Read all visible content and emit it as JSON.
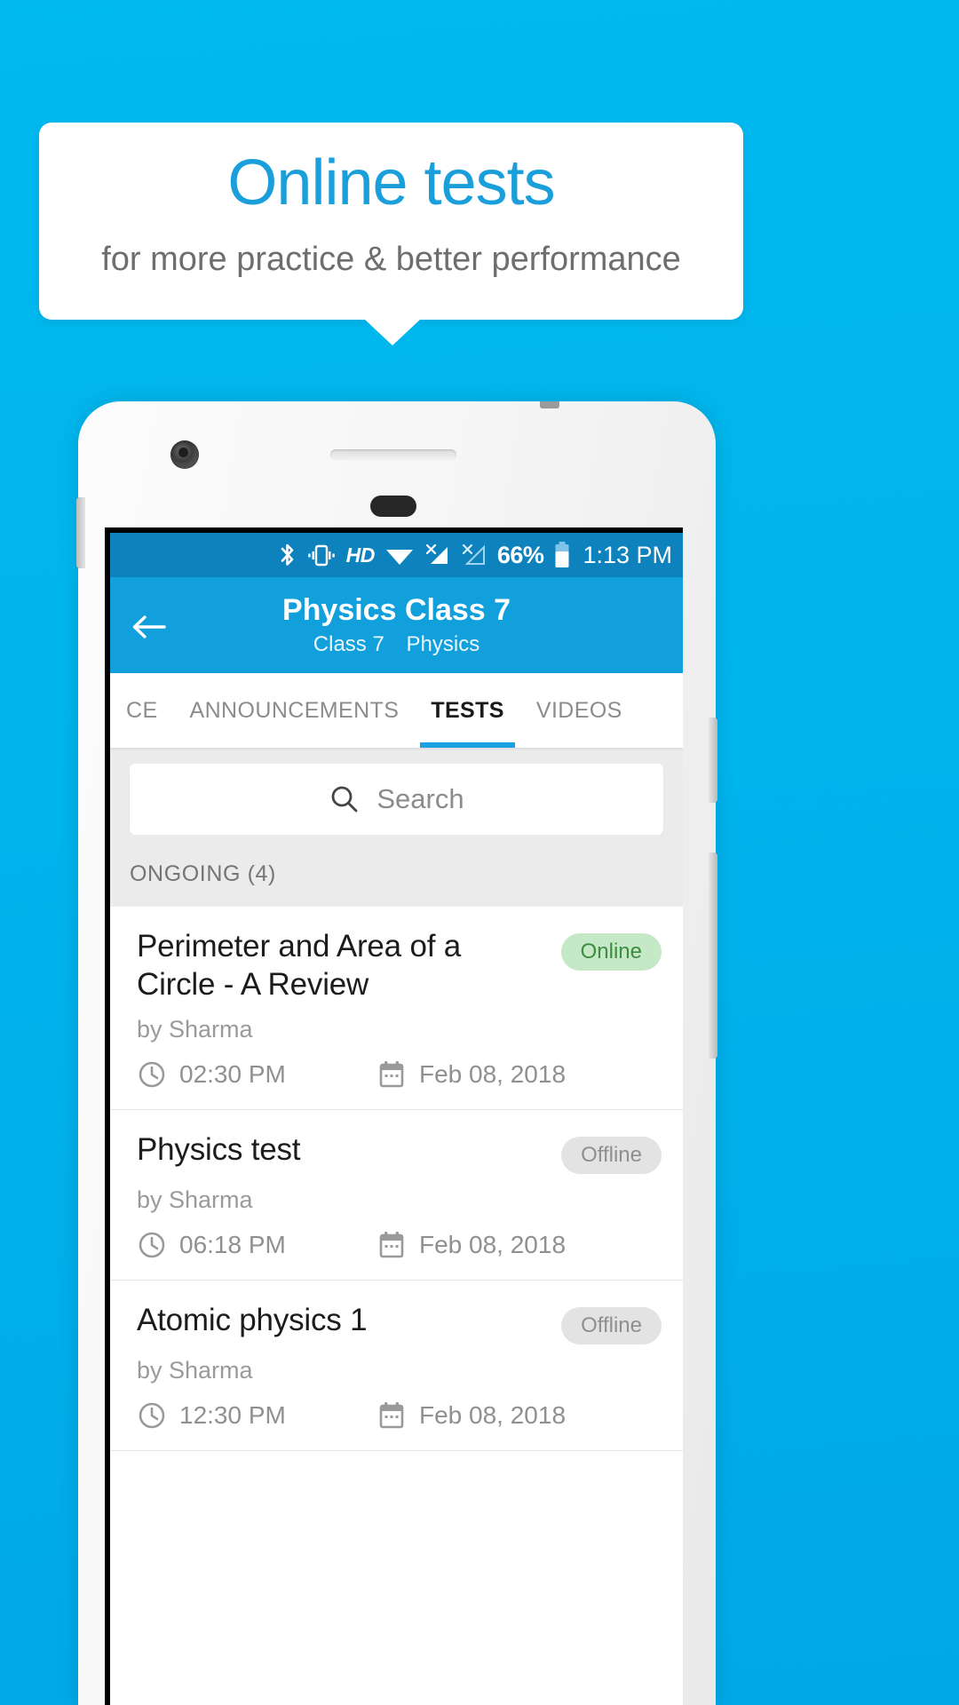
{
  "promo": {
    "title": "Online tests",
    "subtitle": "for more practice & better performance",
    "accent_color": "#1a9fdb",
    "background_color": "#00b4ec"
  },
  "statusbar": {
    "icons": [
      "bluetooth-icon",
      "vibrate-icon",
      "hd-icon",
      "wifi-icon",
      "signal-sim1-icon",
      "signal-sim2-icon"
    ],
    "hd_label": "HD",
    "battery_percent": "66%",
    "battery_icon": "battery-icon",
    "time": "1:13 PM"
  },
  "appbar": {
    "back_icon": "back-arrow-icon",
    "title": "Physics Class 7",
    "subtitle_class": "Class 7",
    "subtitle_subject": "Physics",
    "background_color": "#11a0dc"
  },
  "tabs": [
    {
      "label": "CE",
      "active": false
    },
    {
      "label": "ANNOUNCEMENTS",
      "active": false
    },
    {
      "label": "TESTS",
      "active": true
    },
    {
      "label": "VIDEOS",
      "active": false
    }
  ],
  "search": {
    "icon": "search-icon",
    "placeholder": "Search",
    "value": ""
  },
  "section": {
    "label": "ONGOING (4)"
  },
  "tests": [
    {
      "title": "Perimeter and Area of a Circle - A Review",
      "author": "by Sharma",
      "status": "Online",
      "status_type": "online",
      "time": "02:30 PM",
      "date": "Feb 08, 2018",
      "clock_icon": "clock-icon",
      "calendar_icon": "calendar-icon"
    },
    {
      "title": "Physics test",
      "author": "by Sharma",
      "status": "Offline",
      "status_type": "offline",
      "time": "06:18 PM",
      "date": "Feb 08, 2018",
      "clock_icon": "clock-icon",
      "calendar_icon": "calendar-icon"
    },
    {
      "title": "Atomic physics 1",
      "author": "by Sharma",
      "status": "Offline",
      "status_type": "offline",
      "time": "12:30 PM",
      "date": "Feb 08, 2018",
      "clock_icon": "clock-icon",
      "calendar_icon": "calendar-icon"
    }
  ]
}
